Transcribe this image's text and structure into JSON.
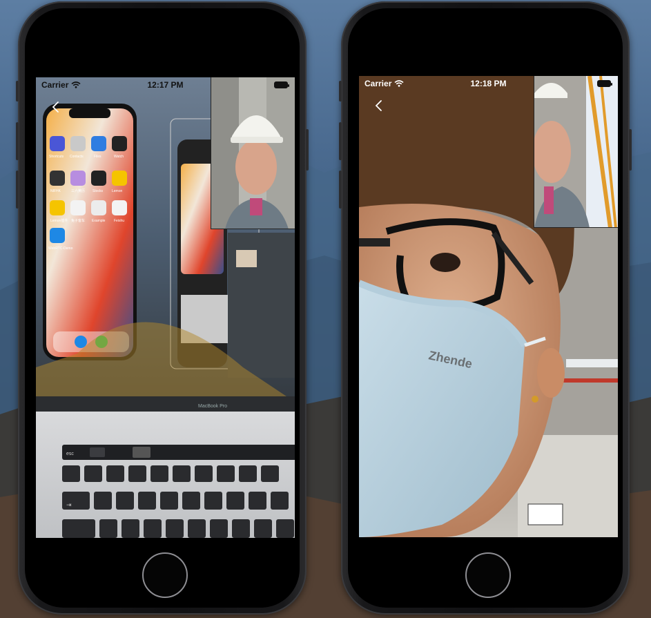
{
  "phones": [
    {
      "status": {
        "carrier": "Carrier",
        "time": "12:17 PM"
      },
      "scene": {
        "laptop_brand": "MacBook Pro",
        "key_esc": "esc",
        "key_tab": "⇥",
        "app_labels": [
          "Shortcuts",
          "Contacts",
          "Files",
          "Watch",
          "NIFHK",
          "三六黄历",
          "Stocks",
          "Lemon",
          "Lemon插件",
          "兔子客车",
          "Example",
          "Feishu",
          "WebRTC-Demo"
        ]
      }
    },
    {
      "status": {
        "carrier": "Carrier",
        "time": "12:18 PM"
      },
      "scene": {
        "mask_text": "Zhende"
      }
    }
  ]
}
